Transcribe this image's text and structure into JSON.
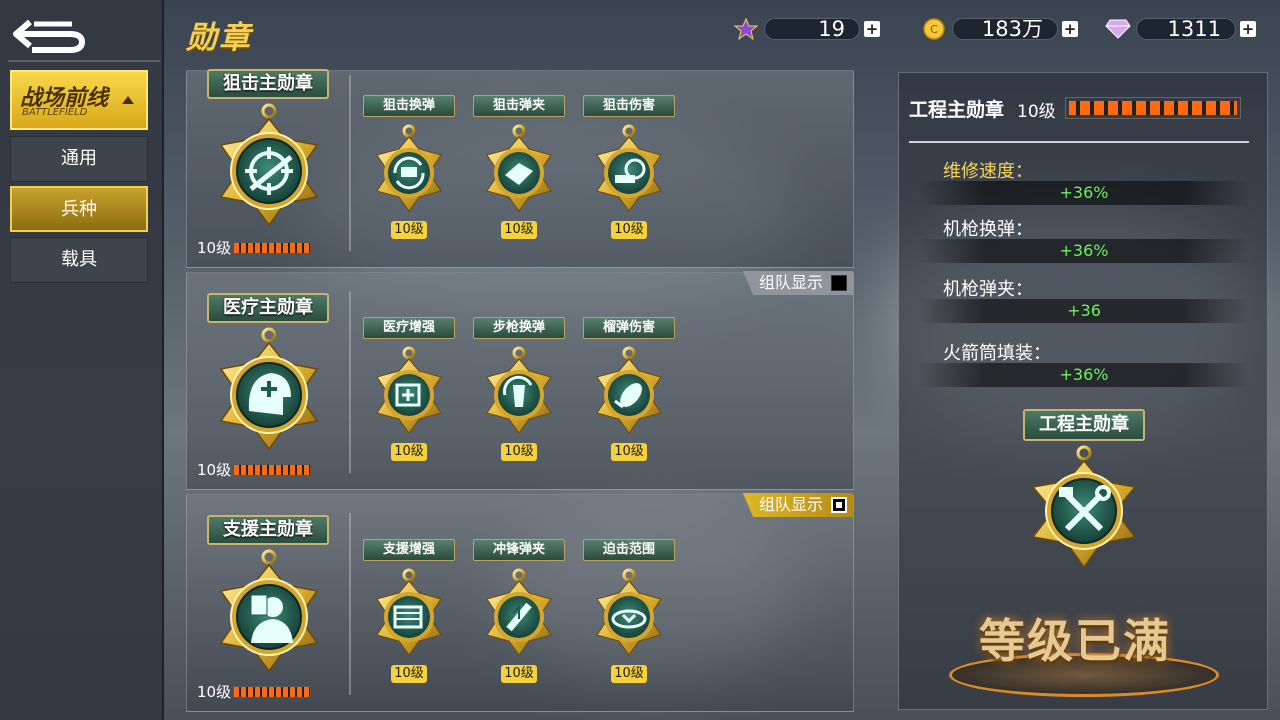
{
  "header": {
    "title": "勋章"
  },
  "currencies": [
    {
      "icon": "medal-platform-icon",
      "value": "19",
      "add": "+"
    },
    {
      "icon": "gold-coin-icon",
      "value": "183万",
      "add": "+"
    },
    {
      "icon": "diamond-icon",
      "value": "1311",
      "add": "+"
    }
  ],
  "sidebar": {
    "category": {
      "label": "战场前线",
      "sub": "BATTLEFIELD"
    },
    "tabs": [
      {
        "label": "通用"
      },
      {
        "label": "兵种"
      },
      {
        "label": "载具"
      }
    ]
  },
  "panels": [
    {
      "main": "狙击主勋章",
      "level": "10级",
      "group_label": "",
      "group_on": false,
      "subs": [
        {
          "name": "狙击换弹",
          "lvl": "10级"
        },
        {
          "name": "狙击弹夹",
          "lvl": "10级"
        },
        {
          "name": "狙击伤害",
          "lvl": "10级"
        }
      ]
    },
    {
      "main": "医疗主勋章",
      "level": "10级",
      "group_label": "组队显示",
      "group_on": false,
      "subs": [
        {
          "name": "医疗增强",
          "lvl": "10级"
        },
        {
          "name": "步枪换弹",
          "lvl": "10级"
        },
        {
          "name": "榴弹伤害",
          "lvl": "10级"
        }
      ]
    },
    {
      "main": "支援主勋章",
      "level": "10级",
      "group_label": "组队显示",
      "group_on": true,
      "subs": [
        {
          "name": "支援增强",
          "lvl": "10级"
        },
        {
          "name": "冲锋弹夹",
          "lvl": "10级"
        },
        {
          "name": "迫击范围",
          "lvl": "10级"
        }
      ]
    }
  ],
  "detail": {
    "title": "工程主勋章",
    "level": "10级",
    "stats": [
      {
        "name": "维修速度：",
        "value": "+36%"
      },
      {
        "name": "机枪换弹：",
        "value": "+36%"
      },
      {
        "name": "机枪弹夹：",
        "value": "+36"
      },
      {
        "name": "火箭筒填装：",
        "value": "+36%"
      }
    ],
    "medal_label": "工程主勋章",
    "maxed": "等级已满"
  },
  "colors": {
    "gold": "#f4cf55",
    "accent_orange": "#ff6a10",
    "stat_green": "#6cf25a",
    "medal_teal": "#1f5a4e"
  }
}
